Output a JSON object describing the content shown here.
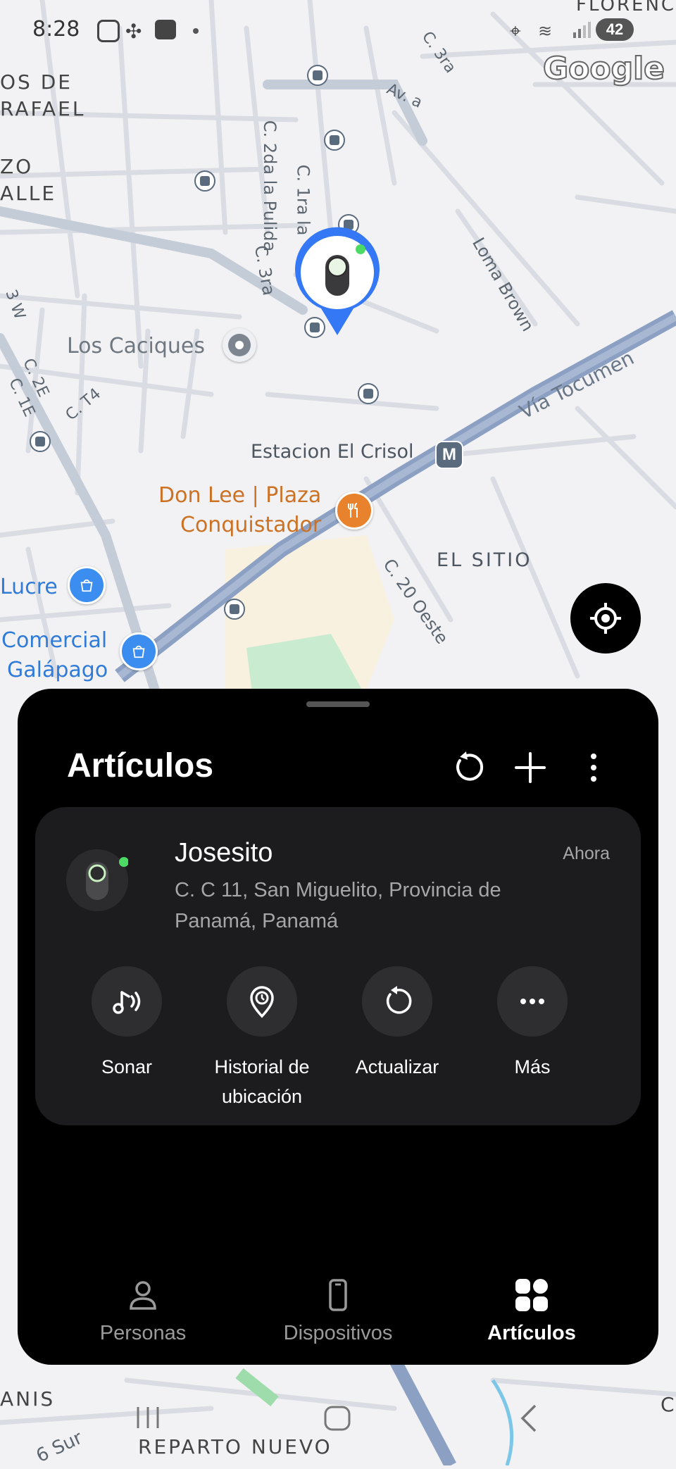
{
  "status_bar": {
    "time": "8:28",
    "battery": "42"
  },
  "map": {
    "attribution": "Google",
    "labels": {
      "c3ra_top": "C. 3ra",
      "ava": "Av. a",
      "c2da": "C. 2da la Pulida",
      "c1ra": "C. 1ra la",
      "c3ra": "C. 3ra",
      "loma": "Loma Brown",
      "caciques": "Los Caciques",
      "tocumen": "Vía Tocumen",
      "crisol": "Estacion El Crisol",
      "donlee1": "Don Lee | Plaza",
      "donlee2": "Conquistador",
      "sitio": "EL SITIO",
      "c20": "C. 20 Oeste",
      "lucre": "Lucre",
      "comercial": "Comercial",
      "galapago": "Galápago",
      "c2e": "C. 2E",
      "c1e": "C. 1E",
      "ct4": "C. T4",
      "w3": "3 W",
      "losde": "OS DE",
      "rafael": "RAFAEL",
      "zo": "ZO",
      "alle": "ALLE",
      "floren": "FLORENC",
      "anis": "ANIS",
      "reparto": "REPARTO NUEVO",
      "sur": "6 Sur",
      "metro": "M",
      "c_right": "C"
    }
  },
  "sheet": {
    "title": "Artículos",
    "item": {
      "name": "Josesito",
      "time": "Ahora",
      "address": "C. C 11, San Miguelito, Provincia de Panamá, Panamá"
    },
    "actions": [
      {
        "label": "Sonar",
        "icon": "sound-icon"
      },
      {
        "label": "Historial de ubicación",
        "icon": "location-history-icon"
      },
      {
        "label": "Actualizar",
        "icon": "refresh-icon"
      },
      {
        "label": "Más",
        "icon": "more-icon"
      }
    ],
    "tabs": [
      {
        "label": "Personas",
        "icon": "person-icon"
      },
      {
        "label": "Dispositivos",
        "icon": "phone-icon"
      },
      {
        "label": "Artículos",
        "icon": "items-grid-icon",
        "active": true
      }
    ]
  },
  "colors": {
    "accent_green": "#4cd964",
    "pin_blue": "#3478f6",
    "poi_orange": "#e8822c",
    "poi_blue": "#3b8ef0"
  }
}
